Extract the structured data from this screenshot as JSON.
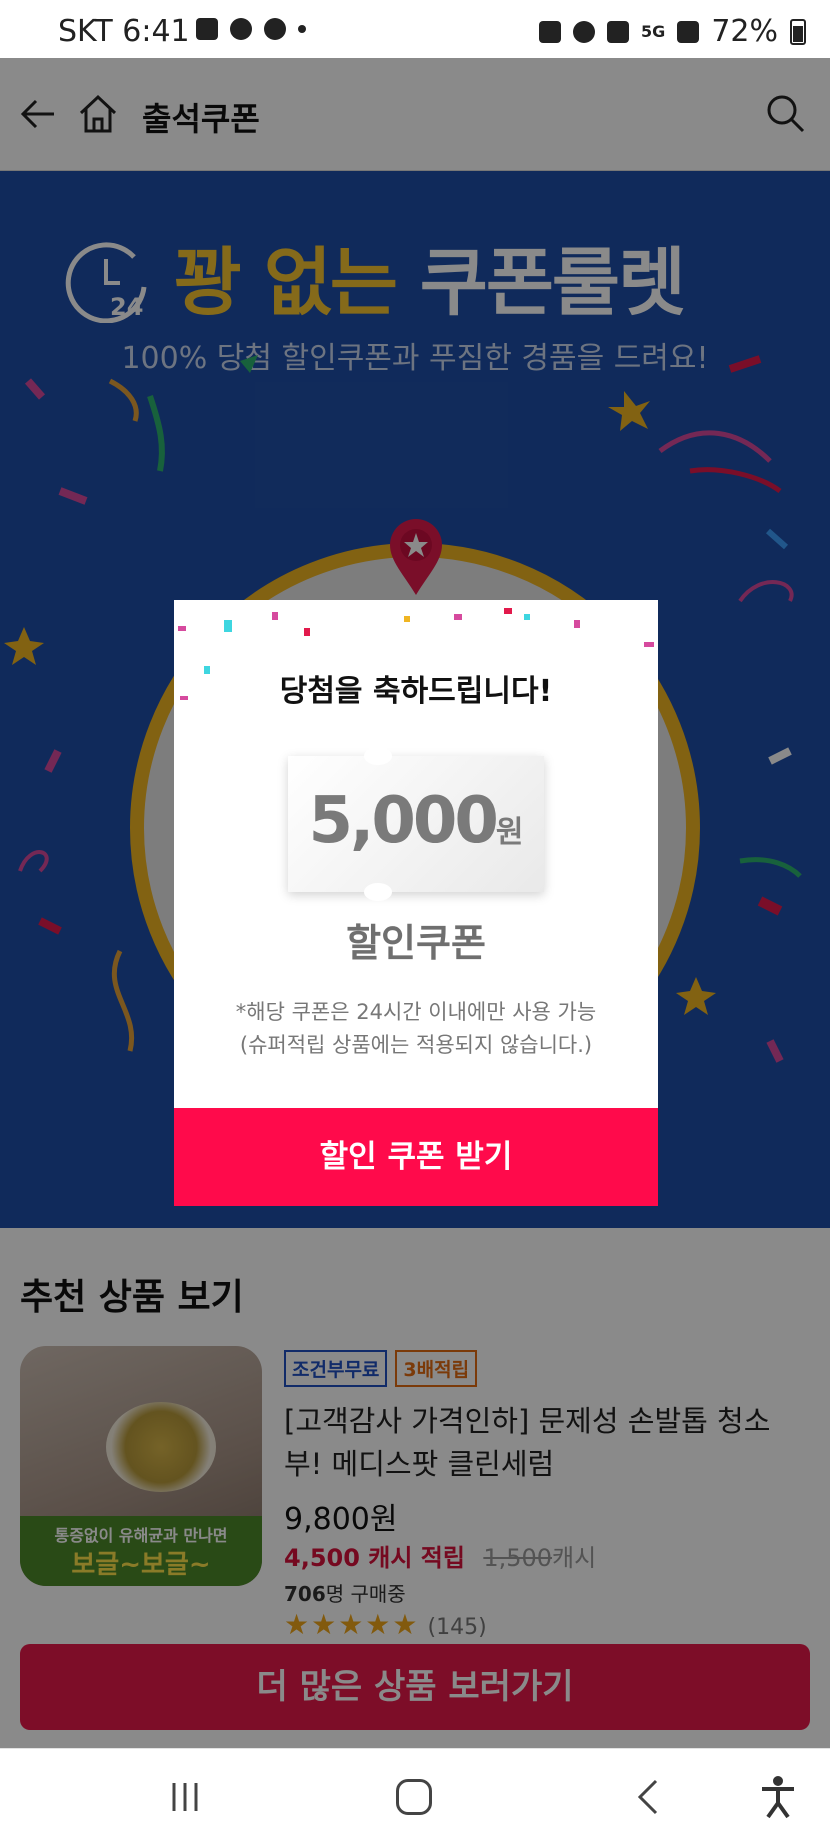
{
  "status_bar": {
    "carrier_time": "SKT 6:41",
    "battery": "72%",
    "lte": "5G"
  },
  "app_bar": {
    "title": "출석쿠폰"
  },
  "banner": {
    "title_gold": "꽝 없는 ",
    "title_white": "쿠폰룰렛",
    "clock_number": "24",
    "subtitle": "100% 당첨 할인쿠폰과 푸짐한 경품을 드려요!"
  },
  "modal": {
    "heading": "당첨을 축하드립니다!",
    "amount": "5,000",
    "currency": "원",
    "coupon_kind": "할인쿠폰",
    "note_line1": "*해당 쿠폰은 24시간 이내에만 사용 가능",
    "note_line2": "(슈퍼적립 상품에는 적용되지 않습니다.)",
    "button_label": "할인 쿠폰 받기"
  },
  "recommended": {
    "title": "추천 상품 보기",
    "product": {
      "badges": [
        "조건부무료",
        "3배적립"
      ],
      "name": "[고객감사 가격인하] 문제성 손발톱 청소부! 메디스팟 클린세럼",
      "price": "9,800원",
      "cash_amount": "4,500",
      "cash_label": "캐시 적립",
      "old_cash": "1,500",
      "old_cash_unit": "캐시",
      "buyers_count": "706",
      "buyers_label": "명 구매중",
      "rating_stars": "★★★★★",
      "review_count": "(145)",
      "rating": 4.5,
      "image_caption_top": "통증없이 유해균과 만나면",
      "image_caption_main": "보글~보글~"
    },
    "more_button": "더 많은 상품 보러가기"
  },
  "colors": {
    "banner_blue": "#1f4fa8",
    "gold": "#f5c531",
    "accent_pink": "#ff0a4b",
    "badge_blue": "#2151c3",
    "badge_orange": "#e36b12"
  }
}
